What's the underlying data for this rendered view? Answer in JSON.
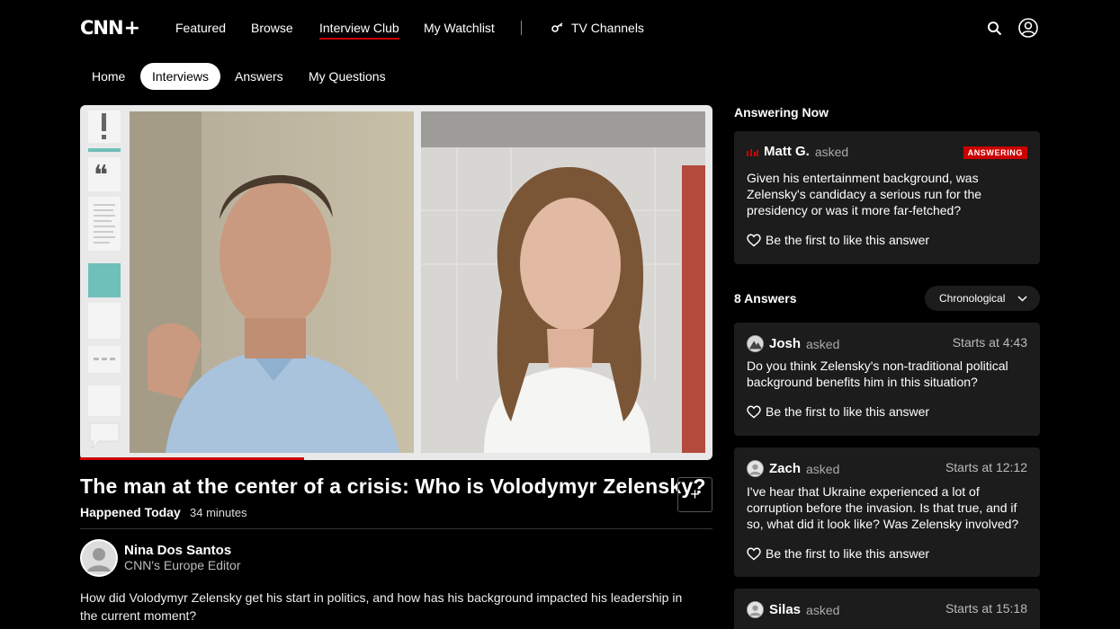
{
  "brand": {
    "logo": "CNN",
    "logo_plus": "+"
  },
  "nav": {
    "items": [
      "Featured",
      "Browse",
      "Interview Club",
      "My Watchlist"
    ],
    "tv_channels": "TV Channels",
    "accent": "#cc0000"
  },
  "subnav": {
    "items": [
      "Home",
      "Interviews",
      "Answers",
      "My Questions"
    ]
  },
  "video": {
    "title": "The man at the center of a crisis: Who is Volodymyr Zelensky?",
    "tag": "Happened Today",
    "duration": "34 minutes",
    "progress_fraction": 0.35,
    "host_name": "Nina Dos Santos",
    "host_role": "CNN's Europe Editor",
    "description": "How did Volodymyr Zelensky get his start in politics, and how has his background impacted his leadership in the current moment?"
  },
  "answering_now": {
    "heading": "Answering Now",
    "badge": "ANSWERING",
    "name": "Matt G.",
    "asked": "asked",
    "question": "Given his entertainment background, was Zelensky's candidacy a serious run for the presidency or was it more far-fetched?",
    "like": "Be the first to like this answer"
  },
  "answers": {
    "heading": "8 Answers",
    "sort": "Chronological",
    "list": [
      {
        "name": "Josh",
        "asked": "asked",
        "starts": "Starts at 4:43",
        "question": "Do you think Zelensky's non-traditional political background benefits him in this situation?",
        "like": "Be the first to like this answer"
      },
      {
        "name": "Zach",
        "asked": "asked",
        "starts": "Starts at 12:12",
        "question": "I've hear that Ukraine experienced a lot of corruption before the invasion. Is that true, and if so, what did it look like? Was Zelensky involved?",
        "like": "Be the first to like this answer"
      },
      {
        "name": "Silas",
        "asked": "asked",
        "starts": "Starts at 15:18"
      }
    ]
  }
}
